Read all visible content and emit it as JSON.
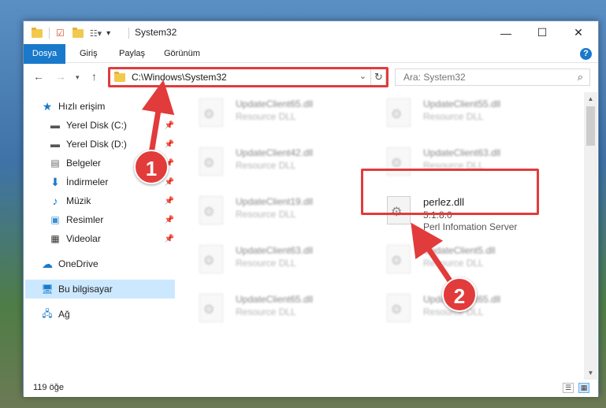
{
  "window": {
    "title": "System32",
    "controls": {
      "minimize": "—",
      "maximize": "☐",
      "close": "✕"
    }
  },
  "ribbon": {
    "tabs": [
      "Dosya",
      "Giriş",
      "Paylaş",
      "Görünüm"
    ],
    "help": "?"
  },
  "nav": {
    "address": "C:\\Windows\\System32",
    "search_placeholder": "Ara: System32"
  },
  "sidebar": {
    "items": [
      {
        "label": "Hızlı erişim",
        "icon": "star-icon"
      },
      {
        "label": "Yerel Disk (C:)",
        "icon": "drive-icon"
      },
      {
        "label": "Yerel Disk (D:)",
        "icon": "drive-icon"
      },
      {
        "label": "Belgeler",
        "icon": "document-icon"
      },
      {
        "label": "İndirmeler",
        "icon": "download-icon"
      },
      {
        "label": "Müzik",
        "icon": "music-icon"
      },
      {
        "label": "Resimler",
        "icon": "image-icon"
      },
      {
        "label": "Videolar",
        "icon": "video-icon"
      },
      {
        "label": "OneDrive",
        "icon": "cloud-icon"
      },
      {
        "label": "Bu bilgisayar",
        "icon": "computer-icon"
      },
      {
        "label": "Ağ",
        "icon": "network-icon"
      }
    ]
  },
  "files": [
    {
      "name": "UpdateClient65.dll",
      "sub": "Resource DLL"
    },
    {
      "name": "UpdateClient55.dll",
      "sub": "Resource DLL"
    },
    {
      "name": "UpdateClient42.dll",
      "sub": "Resource DLL"
    },
    {
      "name": "UpdateClient63.dll",
      "sub": "Resource DLL"
    },
    {
      "name": "UpdateClient19.dll",
      "sub": "Resource DLL"
    },
    {
      "name": "perlez.dll",
      "sub": "5.1.8.0",
      "sub2": "Perl Infomation Server"
    },
    {
      "name": "UpdateClient63.dll",
      "sub": "Resource DLL"
    },
    {
      "name": "UpdateClient5.dll",
      "sub": "Resource DLL"
    },
    {
      "name": "UpdateClient65.dll",
      "sub": "Resource DLL"
    },
    {
      "name": "UpdateClient65.dll",
      "sub": "Resource DLL"
    }
  ],
  "status": {
    "count": "119 öğe"
  },
  "callouts": [
    "1",
    "2"
  ],
  "colors": {
    "accent": "#1979ca",
    "highlight": "#e23b3b",
    "selection": "#cce8ff"
  }
}
